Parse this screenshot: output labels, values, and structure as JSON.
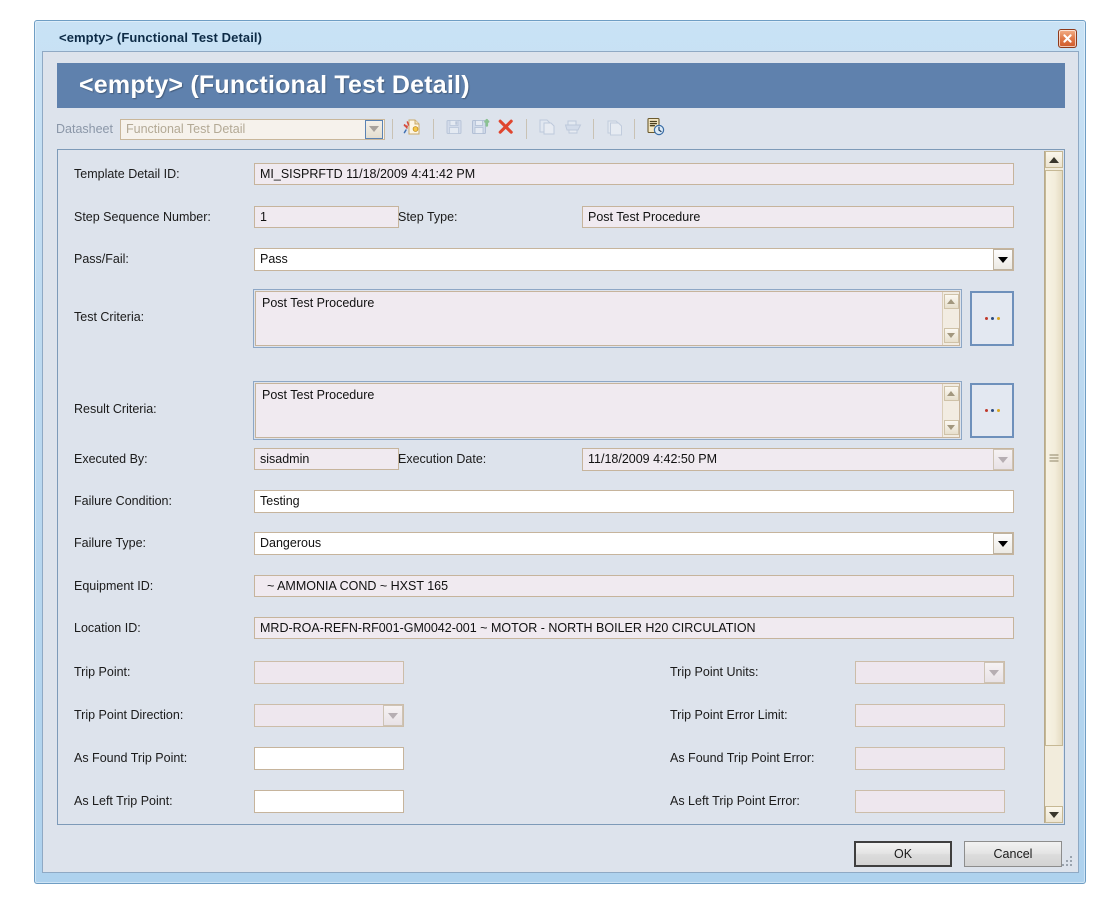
{
  "window": {
    "titlebar_text": "<empty> (Functional Test Detail)",
    "close_icon": "close-icon",
    "banner_title": "<empty> (Functional Test Detail)",
    "accent_banner": "#5f81ad",
    "accent_titlebar": "#c9e2f5"
  },
  "toolbar": {
    "datasheet_label": "Datasheet",
    "datasheet_value": "Functional Test Detail",
    "datasheet_enabled": "false",
    "buttons": [
      {
        "name": "new-datasheet-icon",
        "title": "New",
        "enabled": "true"
      },
      {
        "name": "save-icon",
        "title": "Save",
        "enabled": "false"
      },
      {
        "name": "save-and-new-icon",
        "title": "Save and New",
        "enabled": "false"
      },
      {
        "name": "delete-icon",
        "title": "Delete",
        "enabled": "true"
      },
      {
        "name": "copy-icon",
        "title": "Copy",
        "enabled": "false"
      },
      {
        "name": "print-icon",
        "title": "Print",
        "enabled": "false"
      },
      {
        "name": "reference-documents-icon",
        "title": "Reference Documents",
        "enabled": "false"
      },
      {
        "name": "history-icon",
        "title": "History",
        "enabled": "true"
      }
    ]
  },
  "form": {
    "fields": {
      "template_detail_id": {
        "label": "Template Detail ID:",
        "value": "MI_SISPRFTD 11/18/2009 4:41:42 PM",
        "state": "readonly"
      },
      "step_sequence_number": {
        "label": "Step Sequence Number:",
        "value": "1",
        "state": "readonly"
      },
      "step_type": {
        "label": "Step Type:",
        "value": "Post Test Procedure",
        "state": "readonly"
      },
      "pass_fail": {
        "label": "Pass/Fail:",
        "value": "Pass",
        "state": "editable",
        "control": "dropdown"
      },
      "test_criteria": {
        "label": "Test Criteria:",
        "value": "Post Test Procedure",
        "state": "readonly",
        "control": "memo"
      },
      "result_criteria": {
        "label": "Result Criteria:",
        "value": "Post Test Procedure",
        "state": "readonly",
        "control": "memo"
      },
      "executed_by": {
        "label": "Executed By:",
        "value": "sisadmin",
        "state": "readonly"
      },
      "execution_date": {
        "label": "Execution Date:",
        "value": "11/18/2009 4:42:50 PM",
        "state": "readonly",
        "control": "dropdown"
      },
      "failure_condition": {
        "label": "Failure Condition:",
        "value": "Testing",
        "state": "editable"
      },
      "failure_type": {
        "label": "Failure Type:",
        "value": "Dangerous",
        "state": "editable",
        "control": "dropdown"
      },
      "equipment_id": {
        "label": "Equipment ID:",
        "value": "~ AMMONIA COND ~ HXST 165",
        "state": "readonly"
      },
      "location_id": {
        "label": "Location ID:",
        "value": "MRD-ROA-REFN-RF001-GM0042-001 ~ MOTOR - NORTH BOILER H20 CIRCULATION",
        "state": "readonly"
      },
      "trip_point": {
        "label": "Trip Point:",
        "value": "",
        "state": "disabled"
      },
      "trip_point_units": {
        "label": "Trip Point Units:",
        "value": "",
        "state": "disabled",
        "control": "dropdown"
      },
      "trip_point_direction": {
        "label": "Trip Point Direction:",
        "value": "",
        "state": "disabled",
        "control": "dropdown"
      },
      "trip_point_error_limit": {
        "label": "Trip Point Error Limit:",
        "value": "",
        "state": "disabled"
      },
      "as_found_trip_point": {
        "label": "As Found Trip Point:",
        "value": "",
        "state": "editable"
      },
      "as_found_trip_point_error": {
        "label": "As Found Trip Point Error:",
        "value": "",
        "state": "disabled"
      },
      "as_left_trip_point": {
        "label": "As Left Trip Point:",
        "value": "",
        "state": "editable"
      },
      "as_left_trip_point_error": {
        "label": "As Left Trip Point Error:",
        "value": "",
        "state": "disabled"
      }
    },
    "ellipsis_label": "•••",
    "scrollbar": {
      "up_icon": "scroll-up-icon",
      "down_icon": "scroll-down-icon"
    }
  },
  "footer": {
    "ok_label": "OK",
    "cancel_label": "Cancel"
  }
}
